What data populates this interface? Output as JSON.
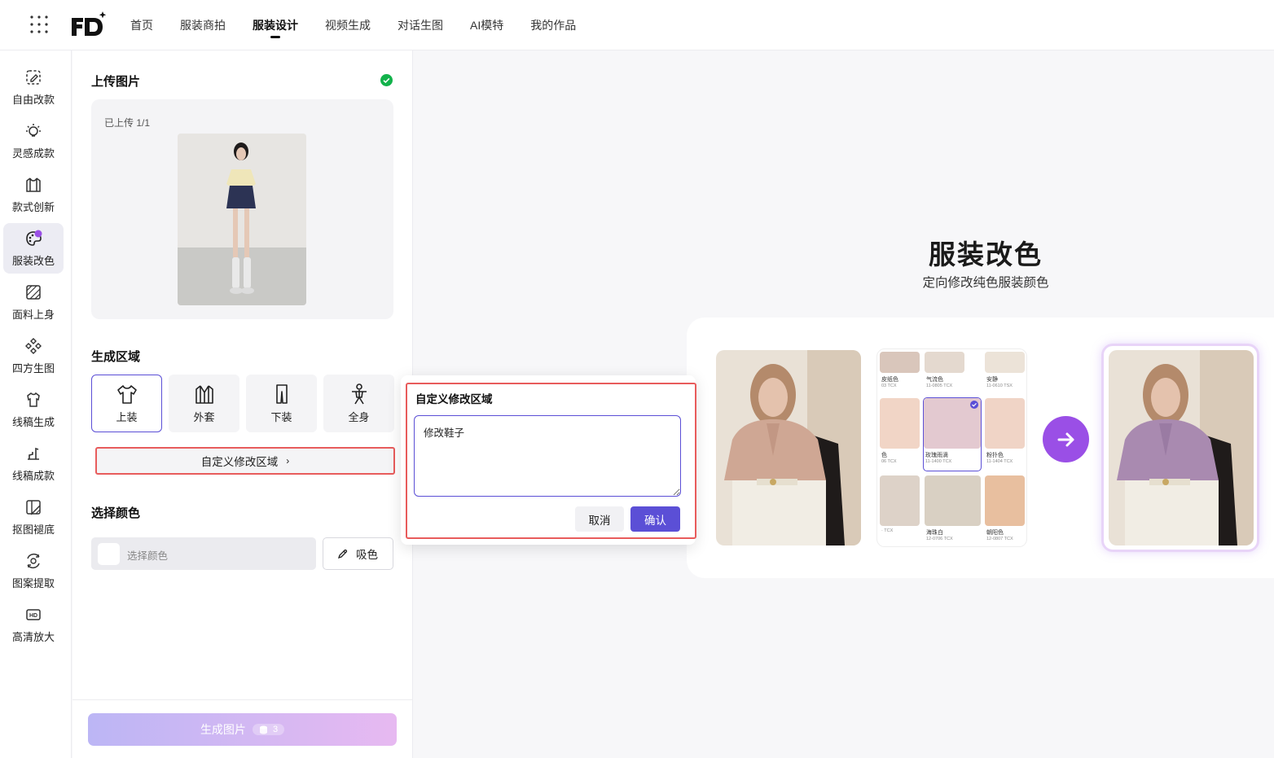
{
  "nav": {
    "items": [
      "首页",
      "服装商拍",
      "服装设计",
      "视频生成",
      "对话生图",
      "AI模特",
      "我的作品"
    ],
    "active_index": 2
  },
  "sidebar": {
    "items": [
      {
        "label": "自由改款",
        "icon": "edit-icon"
      },
      {
        "label": "灵感成款",
        "icon": "bulb-icon"
      },
      {
        "label": "款式创新",
        "icon": "garment-icon"
      },
      {
        "label": "服装改色",
        "icon": "palette-icon",
        "active": true
      },
      {
        "label": "面料上身",
        "icon": "fabric-icon"
      },
      {
        "label": "四方生图",
        "icon": "diamond-grid-icon"
      },
      {
        "label": "线稿生成",
        "icon": "sketch-icon"
      },
      {
        "label": "线稿成款",
        "icon": "sketch-style-icon"
      },
      {
        "label": "抠图褪底",
        "icon": "cutout-icon"
      },
      {
        "label": "图案提取",
        "icon": "pattern-icon"
      },
      {
        "label": "高清放大",
        "icon": "hd-icon"
      }
    ]
  },
  "panel": {
    "upload_title": "上传图片",
    "upload_count": "已上传 1/1",
    "area_title": "生成区域",
    "areas": [
      "上装",
      "外套",
      "下装",
      "全身"
    ],
    "custom_area_label": "自定义修改区域",
    "color_title": "选择颜色",
    "color_placeholder": "选择颜色",
    "pick_color_label": "吸色",
    "generate_label": "生成图片",
    "generate_cost": "3"
  },
  "popup": {
    "title": "自定义修改区域",
    "text": "修改鞋子",
    "cancel": "取消",
    "confirm": "确认"
  },
  "main": {
    "title": "服装改色",
    "subtitle": "定向修改纯色服装颜色"
  },
  "swatches": [
    {
      "name": "皮纸色",
      "code": "03 TCX",
      "color": "#d9c6bb"
    },
    {
      "name": "气流色",
      "code": "11-0805 TCX",
      "color": "#e4d9cf"
    },
    {
      "name": "安静",
      "code": "11-0610 TSX",
      "color": "#ece3d8"
    },
    {
      "name": "色",
      "code": "06 TCX",
      "color": "#f1d5c6"
    },
    {
      "name": "玫瑰雨滴",
      "code": "11-1400 TCX",
      "color": "#e3c9d0",
      "selected": true
    },
    {
      "name": "粉扑色",
      "code": "11-1404 TCX",
      "color": "#f0d4c6"
    },
    {
      "name": "",
      "code": "· TCX",
      "color": "#ddd2c8"
    },
    {
      "name": "海珠白",
      "code": "12-0706 TCX",
      "color": "#d9d0c3"
    },
    {
      "name": "朝阳色",
      "code": "12-0807 TCX",
      "color": "#e8bf9f"
    }
  ],
  "colors": {
    "accent": "#5b4fd6",
    "arrow": "#9a4fe6",
    "highlight": "#e85c5c",
    "success": "#12b24b"
  }
}
